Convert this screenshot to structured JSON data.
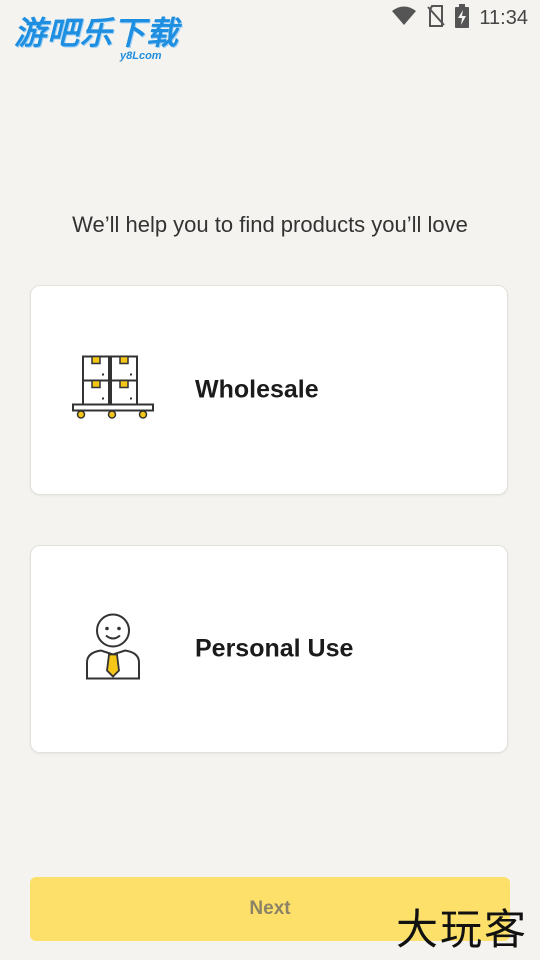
{
  "status_bar": {
    "time": "11:34",
    "icons": [
      "wifi-icon",
      "no-sim-icon",
      "battery-charging-icon"
    ]
  },
  "watermark_top": {
    "title": "游吧乐下载",
    "subtitle": "y8Lcom"
  },
  "onboarding": {
    "prompt": "We’ll help you to find products you’ll love",
    "options": [
      {
        "label": "Wholesale",
        "icon": "pallet-boxes-icon"
      },
      {
        "label": "Personal Use",
        "icon": "person-tie-icon"
      }
    ],
    "next_label": "Next"
  },
  "watermark_bottom": "大玩客",
  "colors": {
    "background": "#f4f3ef",
    "accent": "#fde06a",
    "icon_accent": "#f5c518"
  }
}
